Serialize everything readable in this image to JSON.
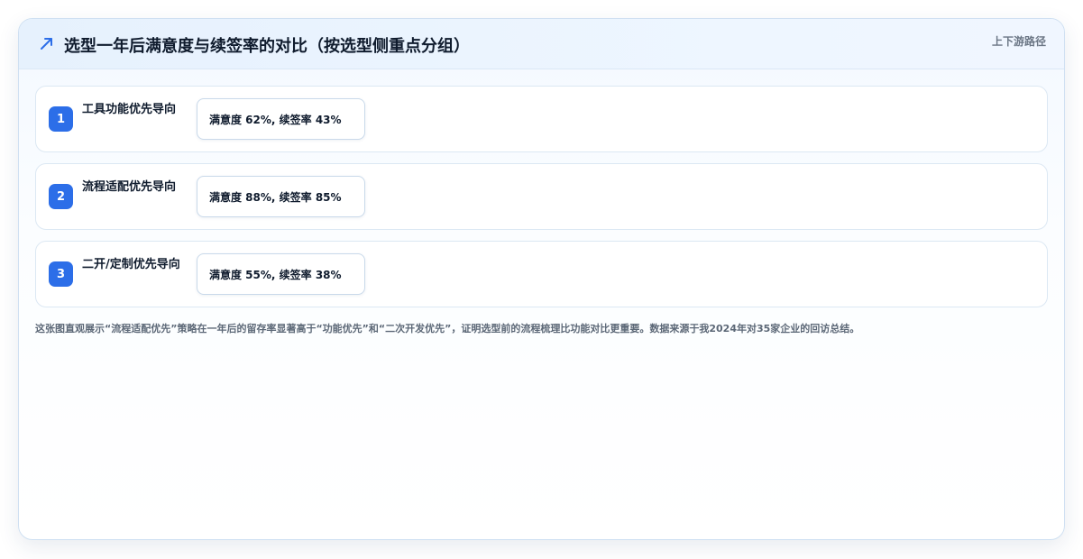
{
  "header": {
    "title": "选型一年后满意度与续签率的对比（按选型侧重点分组）",
    "tag": "上下游路径",
    "icon": "trend-arrow-icon"
  },
  "rows": [
    {
      "index": "1",
      "label": "工具功能优先导向",
      "value": "满意度 62%, 续签率 43%"
    },
    {
      "index": "2",
      "label": "流程适配优先导向",
      "value": "满意度 88%, 续签率 85%"
    },
    {
      "index": "3",
      "label": "二开/定制优先导向",
      "value": "满意度 55%, 续签率 38%"
    }
  ],
  "note": "这张图直观展示“流程适配优先”策略在一年后的留存率显著高于“功能优先”和“二次开发优先”，证明选型前的流程梳理比功能对比更重要。数据来源于我2024年对35家企业的回访总结。",
  "colors": {
    "accent": "#2c6ee8",
    "title": "#0f1b2d",
    "muted": "#6b7685"
  }
}
